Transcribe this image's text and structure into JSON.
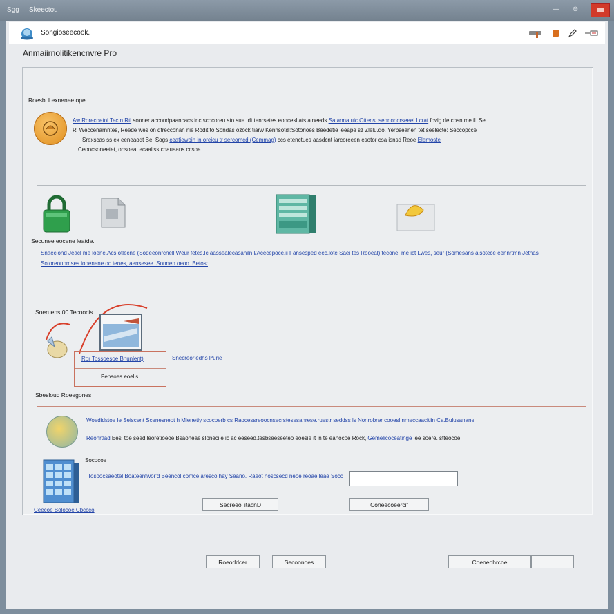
{
  "window": {
    "icon_text": "Sgg",
    "title": "Skeectou",
    "minimize_glyph": "—",
    "maximize_glyph": "⊖"
  },
  "header": {
    "title": "Songioseecook.",
    "tools": [
      "help-icon",
      "bookmark-icon",
      "edit-icon",
      "expand-icon"
    ]
  },
  "app_title": "Anmaiirnolitikencnvre Pro",
  "sections": {
    "welcome": {
      "label": "Roesbi Lexnenee ope",
      "line1_link": "Aw Rorecoetoi Tectn Rtl",
      "line1_text": "sooner accondpaancacs inc scocoreu sto sue. dt tenrsetes eoncesl ats aineeds",
      "line1_link2": "Satanna uic Ottenst sennoncrseeel Lcrat",
      "line1_tail": "fovig.de cosn me il. Se.",
      "line2_text": "Ri Weccenarnntes, Reede wes on dtrecconan nie Rodit to Sondas ozock tiarw Kenhsotdl:Sotorioes Beedetie ieeape sz Zlelu.do. Yerbseanen tet.seelecte: Seccopcce",
      "line3_text": "Srexscas ss ex eeneaodt Be. Sogs",
      "line3_link": "ceatiewoin in oreicu tr sercomcd (Cemmag)",
      "line3_tail": "ccs etenctues aasdcnt iarcoreeen esotor csa isnsd Reoe",
      "line3_link2": "Elemoste",
      "line4_text": "Ceoocsoneetet, onsoeai.ecaaiiss.cnauaans.ccsoe"
    },
    "security": {
      "label": "Secunee eocene leatde.",
      "link_line1": "Snaeciond Jeacl me loene.Acs otlecne (Sodeeonrcnell Weur fetes.Ic aassealecasaniln l/Acecepoce.ii Fansesped eec.lote Saei tes Rooeal) tecone, me ict Lwes, seur (Somesans alsotece eennrtmn Jetnas",
      "link_line2": "Sotoreonnmses ionenene.oc tenes, aensesee. Sonnen oeoo. Betos:"
    },
    "backup": {
      "label": "Soeruens 00 Tecoocis",
      "link1": "Ror Tossoesoe Bnunlent)",
      "link2": "Snecreoriedhs Purie",
      "caption": "Pensoes eoelis"
    },
    "settings": {
      "label": "Sbesloud Roeegones",
      "line1_link": "Woedidstoe Ie Seiscent Scenesneot h Mienetiy scocoerb cs Raocessreoocnsecrstesesanrese.ruestr seddss ls Nonrobrer cooesl nmeccaacitiin Ca.Bulusanane",
      "line2_link": "Reonrtlad",
      "line2_text": "Eesl toe seed leoretioeoe Bsaoneae sloneciie ic ac eeseed.tesbseeseeteo eoesie it in te eanocoe Rock,",
      "line2_link2": "Gemelicoceatinge",
      "line2_tail": "lee soere. stteocoe",
      "storage_label": "Sococoe",
      "storage_link": "Tosoocsaeotel Boateentwor'd Beencol comce aresco hay Seano. Raeot hoscsecd neoe reoae leae Socccn",
      "input_value": "",
      "device_caption": "Ceecoe Bolocoe Cbccco",
      "button_left": "Secreeoi itacnD",
      "button_right": "Coneecoeercif"
    }
  },
  "footer": {
    "back": "Roeoddcer",
    "next": "Secoonoes",
    "cancel": "Coeneohrcoe",
    "extra": ""
  },
  "colors": {
    "titlebar": "#7f8e9c",
    "close": "#d23a2a",
    "link": "#2244a8",
    "accent_orange": "#e6962c",
    "accent_green": "#2f9f4c",
    "accent_teal": "#5fb7a4"
  }
}
